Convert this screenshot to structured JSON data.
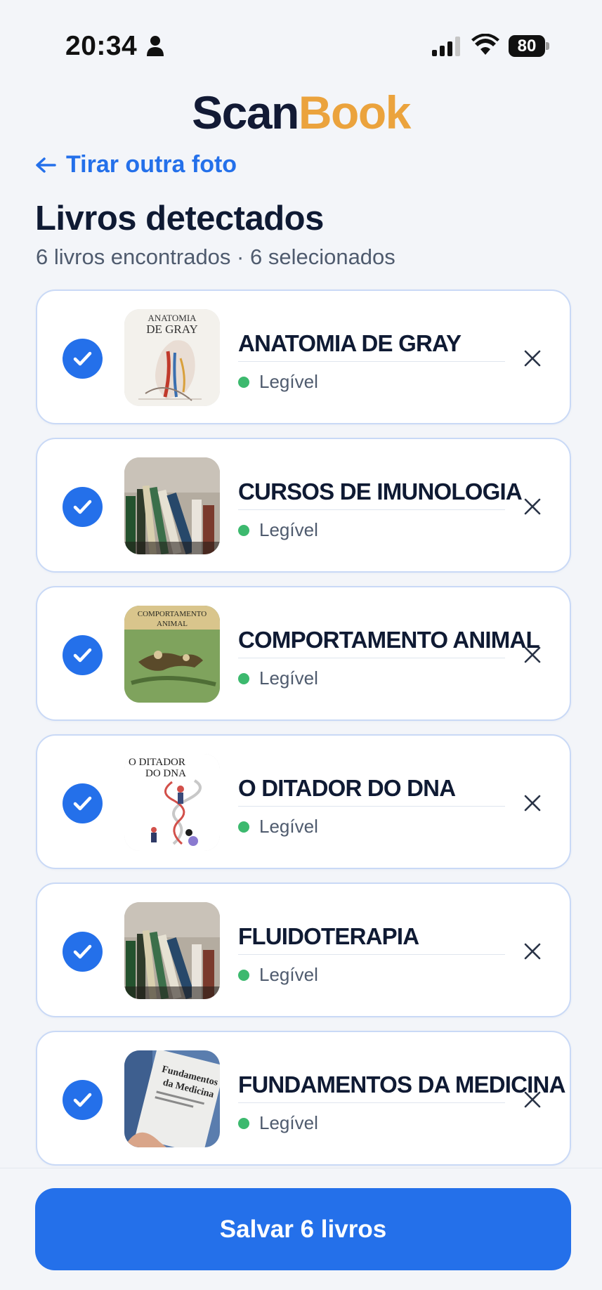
{
  "status_bar": {
    "time": "20:34",
    "battery": "80"
  },
  "logo": {
    "part1": "Scan",
    "part2": "Book",
    "accent_color": "#eba33d",
    "primary_color": "#121a35"
  },
  "header": {
    "back_label": "Tirar outra foto",
    "title": "Livros detectados",
    "summary": "6 livros encontrados · 6 selecionados"
  },
  "books": [
    {
      "title": "ANATOMIA DE GRAY",
      "status": "Legível",
      "selected": true,
      "cover_text": [
        "ANATOMIA",
        "DE GRAY"
      ]
    },
    {
      "title": "CURSOS DE IMUNOLOGIA",
      "status": "Legível",
      "selected": true
    },
    {
      "title": "COMPORTAMENTO ANIMAL",
      "status": "Legível",
      "selected": true,
      "cover_text": [
        "COMPORTAMENTO",
        "ANIMAL"
      ]
    },
    {
      "title": "O DITADOR DO DNA",
      "status": "Legível",
      "selected": true,
      "cover_text": [
        "O DITADOR",
        "DO DNA"
      ]
    },
    {
      "title": "FLUIDOTERAPIA",
      "status": "Legível",
      "selected": true
    },
    {
      "title": "FUNDAMENTOS DA MEDICINA",
      "status": "Legível",
      "selected": true,
      "cover_text": [
        "Fundamentos",
        "da Medicina"
      ]
    }
  ],
  "save_button": {
    "label": "Salvar 6 livros",
    "color": "#2470ea"
  },
  "colors": {
    "legible_dot": "#3cb96e",
    "link": "#2470ea"
  }
}
